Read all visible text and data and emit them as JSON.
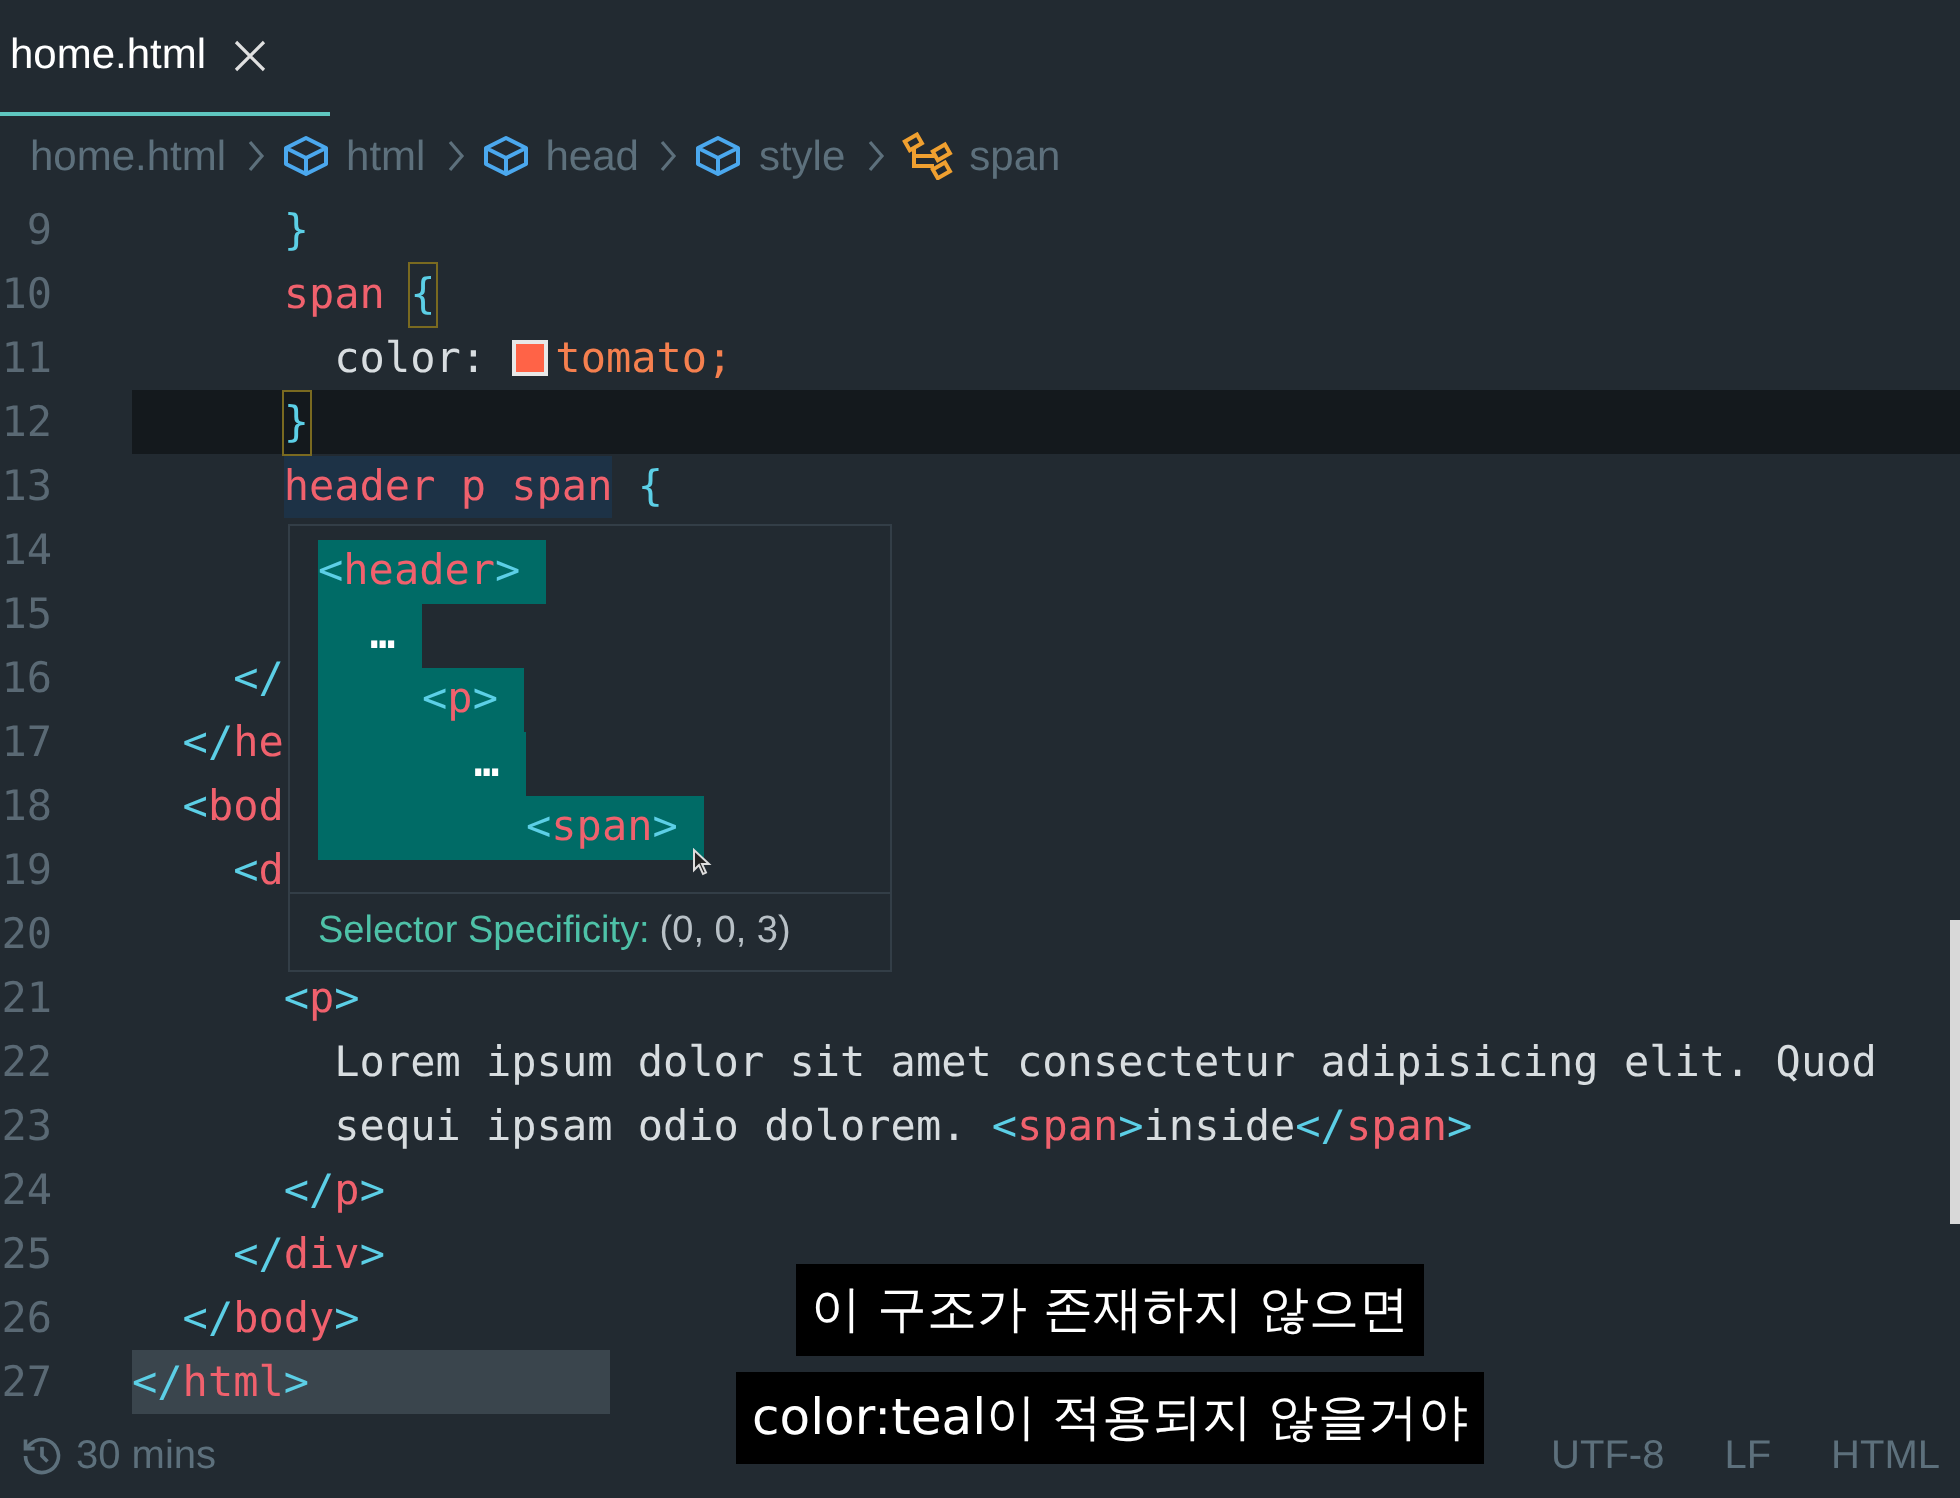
{
  "tab": {
    "title": "home.html",
    "selected": true
  },
  "breadcrumb": [
    {
      "label": "home.html",
      "kind": "file"
    },
    {
      "label": "html",
      "kind": "element"
    },
    {
      "label": "head",
      "kind": "element"
    },
    {
      "label": "style",
      "kind": "element"
    },
    {
      "label": "span",
      "kind": "selector"
    }
  ],
  "lines": [
    {
      "number": "9",
      "tokens": [
        {
          "text": "      }",
          "kind": "punct"
        }
      ]
    },
    {
      "number": "10",
      "tokens": [
        {
          "text": "      span ",
          "kind": "tag"
        },
        {
          "text": "{",
          "kind": "punct",
          "matched": true
        }
      ]
    },
    {
      "number": "11",
      "tokens": [
        {
          "text": "        color: ",
          "kind": "text"
        },
        {
          "kind": "swatch",
          "color": "#ff6347"
        },
        {
          "text": "tomato;",
          "kind": "value"
        }
      ]
    },
    {
      "number": "12",
      "current": true,
      "tokens": [
        {
          "text": "      }",
          "kind": "punct",
          "matched": true
        }
      ]
    },
    {
      "number": "13",
      "tokens": [
        {
          "text": "      header p span",
          "kind": "tag",
          "highlighted": true
        },
        {
          "text": " {",
          "kind": "punct"
        }
      ]
    },
    {
      "number": "14"
    },
    {
      "number": "15"
    },
    {
      "number": "16",
      "tokens": [
        {
          "text": "    </",
          "kind": "punct"
        }
      ]
    },
    {
      "number": "17",
      "tokens": [
        {
          "text": "  </",
          "kind": "punct"
        },
        {
          "text": "he",
          "kind": "tag"
        }
      ]
    },
    {
      "number": "18",
      "tokens": [
        {
          "text": "  <",
          "kind": "punct"
        },
        {
          "text": "bod",
          "kind": "tag"
        }
      ]
    },
    {
      "number": "19",
      "tokens": [
        {
          "text": "    <",
          "kind": "punct"
        },
        {
          "text": "d",
          "kind": "tag"
        }
      ]
    },
    {
      "number": "20"
    },
    {
      "number": "21",
      "tokens": [
        {
          "text": "      <",
          "kind": "punct"
        },
        {
          "text": "p",
          "kind": "tag"
        },
        {
          "text": ">",
          "kind": "punct"
        }
      ]
    },
    {
      "number": "22",
      "tokens": [
        {
          "text": "        Lorem ipsum dolor sit amet consectetur adipisicing elit. Quod",
          "kind": "text"
        }
      ]
    },
    {
      "number": "23",
      "tokens": [
        {
          "text": "        sequi ipsam odio dolorem. ",
          "kind": "text"
        },
        {
          "text": "<",
          "kind": "punct"
        },
        {
          "text": "span",
          "kind": "tag"
        },
        {
          "text": ">",
          "kind": "punct"
        },
        {
          "text": "inside",
          "kind": "text"
        },
        {
          "text": "</",
          "kind": "punct"
        },
        {
          "text": "span",
          "kind": "tag"
        },
        {
          "text": ">",
          "kind": "punct"
        }
      ]
    },
    {
      "number": "24",
      "tokens": [
        {
          "text": "      </",
          "kind": "punct"
        },
        {
          "text": "p",
          "kind": "tag"
        },
        {
          "text": ">",
          "kind": "punct"
        }
      ]
    },
    {
      "number": "25",
      "tokens": [
        {
          "text": "    </",
          "kind": "punct"
        },
        {
          "text": "div",
          "kind": "tag"
        },
        {
          "text": ">",
          "kind": "punct"
        }
      ]
    },
    {
      "number": "26",
      "tokens": [
        {
          "text": "  </",
          "kind": "punct"
        },
        {
          "text": "body",
          "kind": "tag"
        },
        {
          "text": ">",
          "kind": "punct"
        }
      ]
    },
    {
      "number": "27",
      "selected": true,
      "tokens": [
        {
          "text": "</",
          "kind": "punct"
        },
        {
          "text": "html",
          "kind": "tag"
        },
        {
          "text": ">",
          "kind": "punct"
        }
      ]
    }
  ],
  "hover": {
    "tree": [
      {
        "open": "<",
        "name": "header",
        "close": ">",
        "kind": "tag",
        "children": [
          {
            "name": "…",
            "kind": "ellipsis",
            "children": [
              {
                "open": "<",
                "name": "p",
                "close": ">",
                "kind": "tag",
                "children": [
                  {
                    "name": "…",
                    "kind": "ellipsis",
                    "children": [
                      {
                        "open": "<",
                        "name": "span",
                        "close": ">",
                        "kind": "tag"
                      }
                    ]
                  }
                ]
              }
            ]
          }
        ]
      }
    ],
    "specificity_label": "Selector Specificity:",
    "specificity_value": "(0, 0, 3)"
  },
  "status_bar": {
    "time": "30 mins",
    "items": [
      "UTF-8",
      "LF",
      "HTML"
    ]
  },
  "captions": [
    "이 구조가 존재하지 않으면",
    "color:teal이 적용되지 않을거야"
  ]
}
